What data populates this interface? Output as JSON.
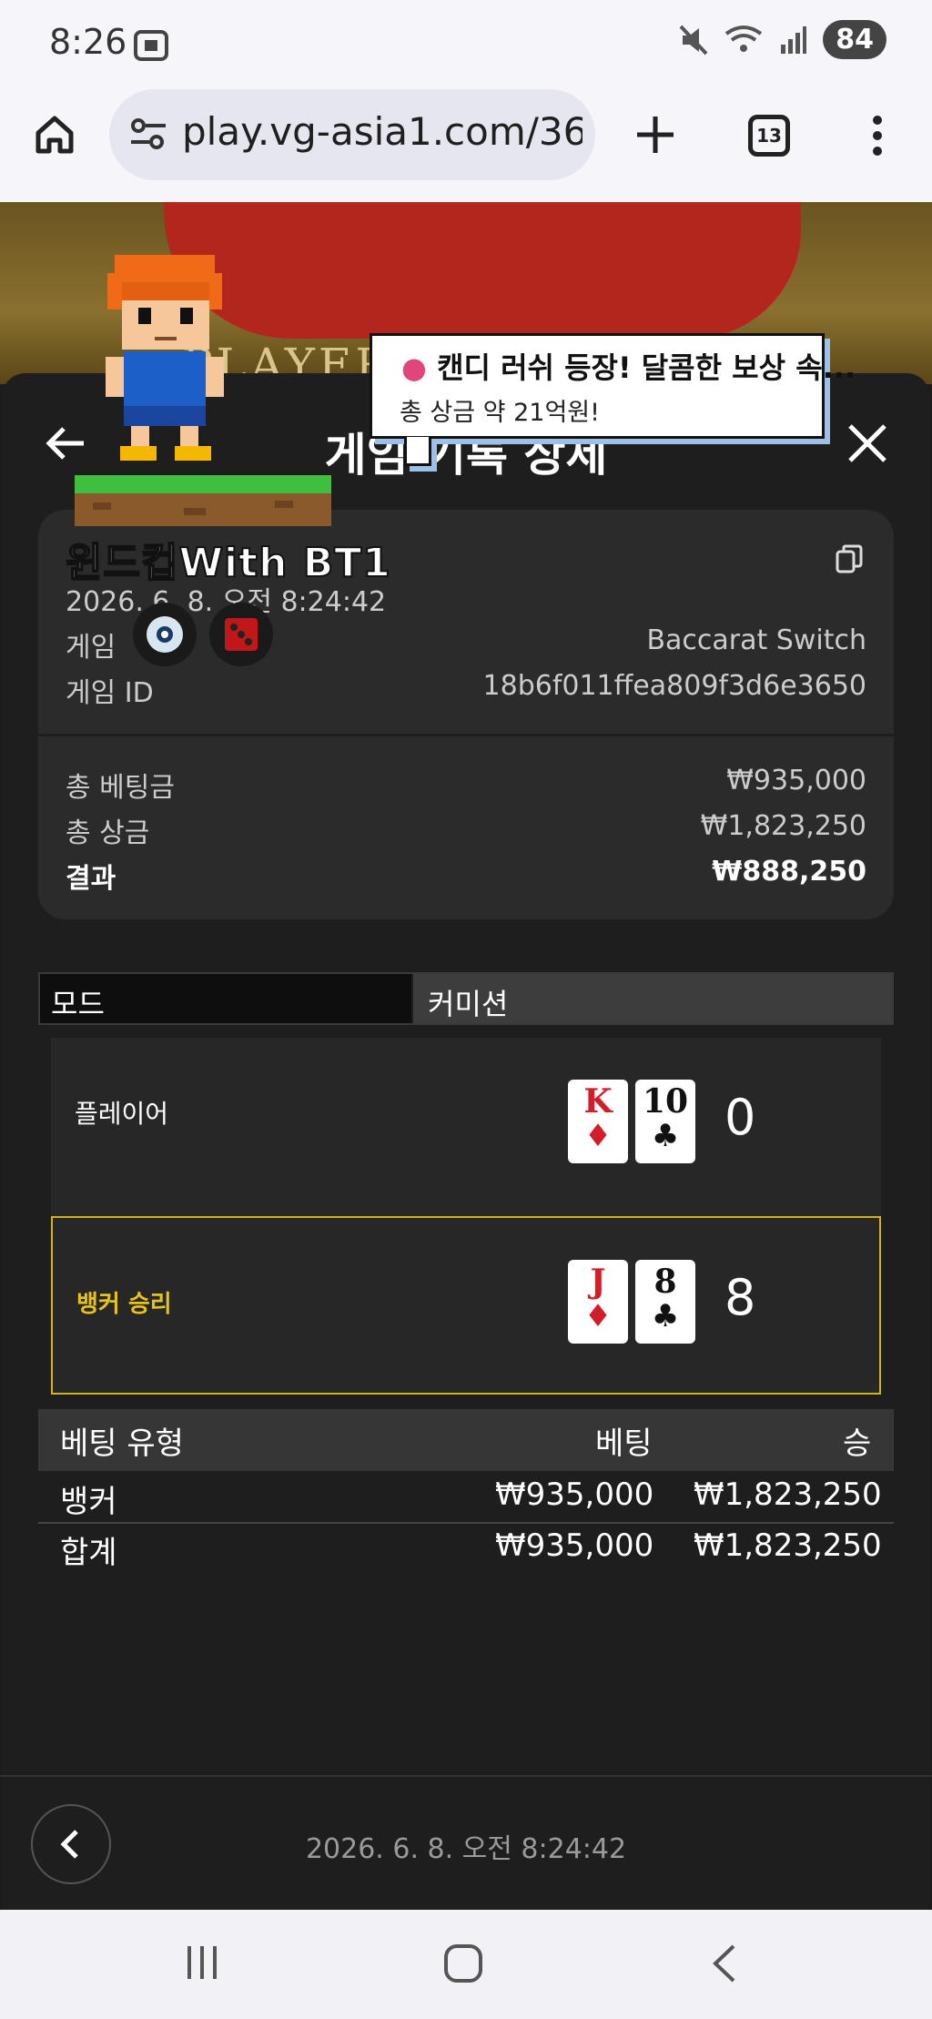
{
  "status_bar": {
    "time": "8:26",
    "battery": "84"
  },
  "browser": {
    "url": "play.vg-asia1.com/364",
    "tab_count": "13"
  },
  "background_text": "PLAYER",
  "popup": {
    "title": "캔디 러쉬 등장! 달콤한 보상 속...",
    "subtitle": "총 상금 약 21억원!"
  },
  "panel": {
    "title": "게임 기록 상세"
  },
  "info": {
    "username": "윈드컵With BT1",
    "datetime": "2026. 6. 8. 오전 8:24:42",
    "game_label": "게임",
    "game_value": "Baccarat Switch",
    "game_id_label": "게임 ID",
    "game_id_value": "18b6f011ffea809f3d6e3650",
    "total_bet_label": "총 베팅금",
    "total_bet_value": "₩935,000",
    "total_win_label": "총 상금",
    "total_win_value": "₩1,823,250",
    "result_label": "결과",
    "result_value": "₩888,250"
  },
  "mode": {
    "label": "모드",
    "value": "커미션"
  },
  "player": {
    "label": "플레이어",
    "cards": [
      {
        "rank": "K",
        "suit": "♦"
      },
      {
        "rank": "10",
        "suit": "♣"
      }
    ],
    "score": "0"
  },
  "banker": {
    "label": "뱅커 승리",
    "cards": [
      {
        "rank": "J",
        "suit": "♦"
      },
      {
        "rank": "8",
        "suit": "♣"
      }
    ],
    "score": "8"
  },
  "bet_table": {
    "headers": [
      "베팅 유형",
      "베팅",
      "승"
    ],
    "rows": [
      [
        "뱅커",
        "₩935,000",
        "₩1,823,250"
      ],
      [
        "합계",
        "₩935,000",
        "₩1,823,250"
      ]
    ]
  },
  "footer": {
    "datetime": "2026. 6. 8. 오전 8:24:42"
  },
  "colors": {
    "banker_highlight": "#d4b21a",
    "panel": "#1e1e1e",
    "card_red": "#d21d2a"
  }
}
